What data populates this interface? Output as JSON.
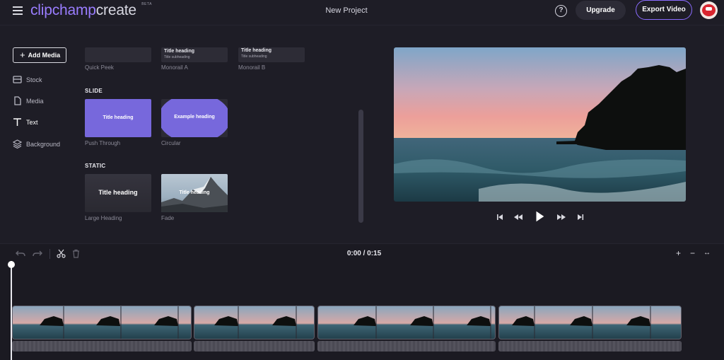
{
  "header": {
    "logo_primary": "clipchamp",
    "logo_secondary": "create",
    "logo_badge": "BETA",
    "project_title": "New Project",
    "help_label": "?",
    "upgrade_label": "Upgrade",
    "export_label": "Export Video",
    "accent_color": "#8b6cff"
  },
  "sidebar": {
    "add_media_label": "Add Media",
    "items": [
      {
        "label": "Stock",
        "icon": "stock-icon"
      },
      {
        "label": "Media",
        "icon": "file-icon"
      },
      {
        "label": "Text",
        "icon": "text-icon",
        "active": true
      },
      {
        "label": "Background",
        "icon": "layers-icon"
      }
    ]
  },
  "text_panel": {
    "top_row": [
      {
        "caption": "Quick Peek"
      },
      {
        "caption": "Monorail A",
        "title": "Title heading",
        "subtitle": "Title subheading"
      },
      {
        "caption": "Monorail B",
        "title": "Title heading",
        "subtitle": "Title subheading"
      }
    ],
    "slide": {
      "header": "SLIDE",
      "items": [
        {
          "caption": "Push Through",
          "text": "Title heading"
        },
        {
          "caption": "Circular",
          "text": "Example heading"
        }
      ]
    },
    "static": {
      "header": "STATIC",
      "items": [
        {
          "caption": "Large Heading",
          "text": "Title heading"
        },
        {
          "caption": "Fade",
          "text": "Title heading"
        }
      ]
    }
  },
  "player": {
    "controls": [
      "skip-back-icon",
      "rewind-icon",
      "play-icon",
      "fast-forward-icon",
      "skip-forward-icon"
    ]
  },
  "timeline": {
    "timecode": "0:00 / 0:15",
    "zoom_in": "+",
    "zoom_out": "−",
    "fit": "↔",
    "clip_count": 4
  }
}
